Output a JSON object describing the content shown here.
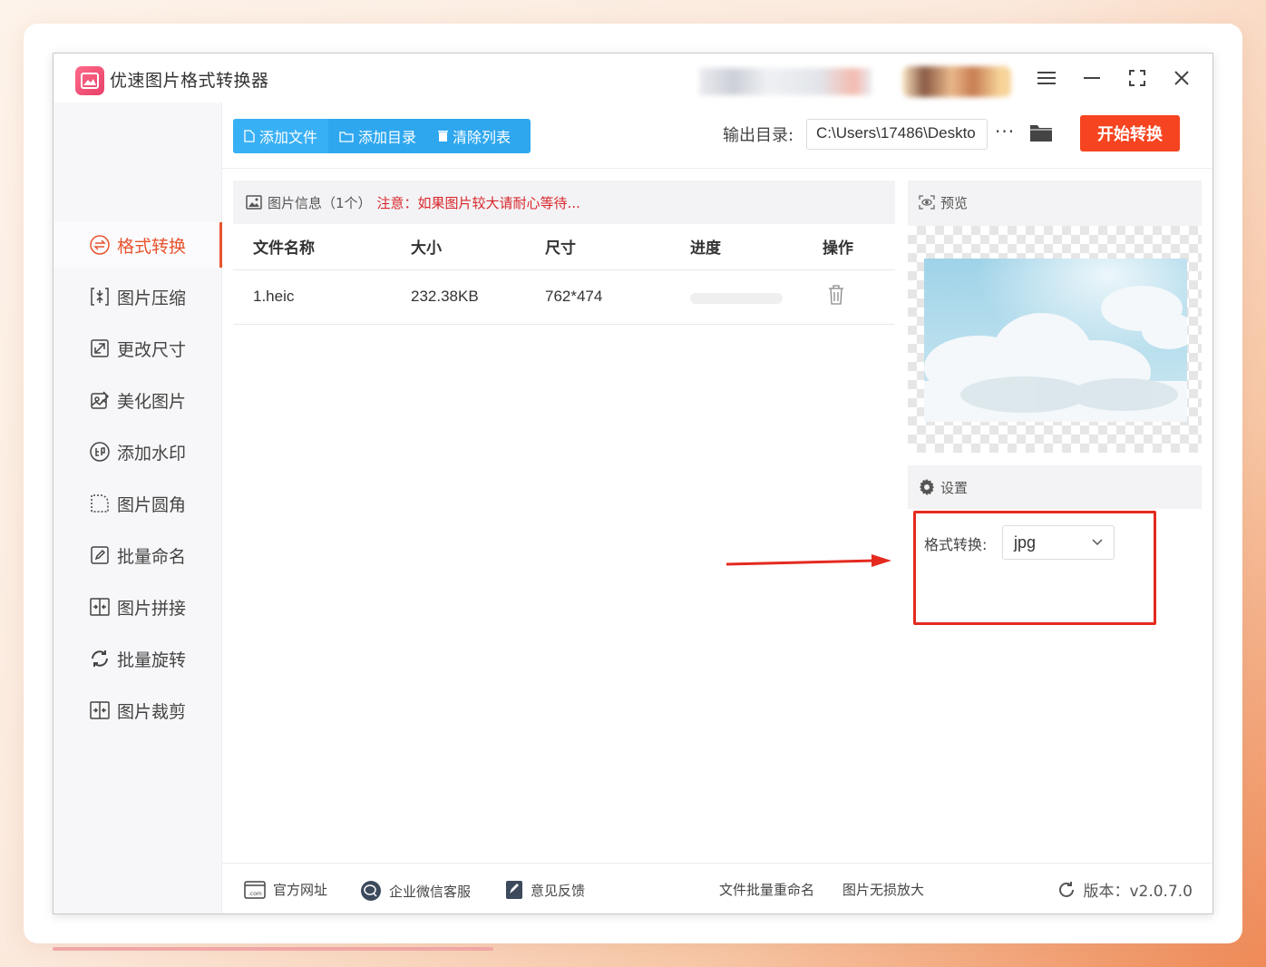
{
  "app": {
    "title": "优速图片格式转换器"
  },
  "toolbar": {
    "add_file": "添加文件",
    "add_folder": "添加目录",
    "clear_list": "清除列表",
    "output_label": "输出目录:",
    "output_path": "C:\\Users\\17486\\Deskto",
    "more": "···",
    "start": "开始转换"
  },
  "sidebar": {
    "items": [
      {
        "label": "格式转换",
        "icon": "convert-icon"
      },
      {
        "label": "图片压缩",
        "icon": "compress-icon"
      },
      {
        "label": "更改尺寸",
        "icon": "resize-icon"
      },
      {
        "label": "美化图片",
        "icon": "beautify-icon"
      },
      {
        "label": "添加水印",
        "icon": "watermark-icon"
      },
      {
        "label": "图片圆角",
        "icon": "rounded-corner-icon"
      },
      {
        "label": "批量命名",
        "icon": "rename-icon"
      },
      {
        "label": "图片拼接",
        "icon": "stitch-icon"
      },
      {
        "label": "批量旋转",
        "icon": "rotate-icon"
      },
      {
        "label": "图片裁剪",
        "icon": "crop-icon"
      }
    ]
  },
  "file_panel": {
    "header_title": "图片信息（1个）",
    "header_note": "注意：如果图片较大请耐心等待...",
    "columns": [
      "文件名称",
      "大小",
      "尺寸",
      "进度",
      "操作"
    ],
    "rows": [
      {
        "name": "1.heic",
        "size": "232.38KB",
        "dimension": "762*474",
        "progress": 0
      }
    ]
  },
  "preview": {
    "title": "预览"
  },
  "settings": {
    "title": "设置",
    "format_label": "格式转换:",
    "format_value": "jpg"
  },
  "footer": {
    "website": "官方网址",
    "wechat": "企业微信客服",
    "feedback": "意见反馈",
    "batch_rename": "文件批量重命名",
    "lossless": "图片无损放大",
    "version": "版本：v2.0.7.0"
  },
  "colors": {
    "accent": "#2ea7ef",
    "start": "#f5441f",
    "active": "#e8532e",
    "highlight": "#e42a1f"
  }
}
